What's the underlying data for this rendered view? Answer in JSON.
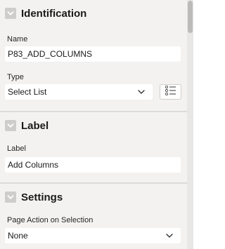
{
  "sections": [
    {
      "title": "Identification",
      "fields": [
        {
          "label": "Name",
          "value": "P83_ADD_COLUMNS"
        },
        {
          "label": "Type",
          "value": "Select List"
        }
      ]
    },
    {
      "title": "Label",
      "fields": [
        {
          "label": "Label",
          "value": "Add Columns"
        }
      ]
    },
    {
      "title": "Settings",
      "fields": [
        {
          "label": "Page Action on Selection",
          "value": "None"
        }
      ]
    }
  ],
  "colors": {
    "panel_bg": "#f3f2f1",
    "toggle_bg": "#cfcdcb",
    "field_bg": "#ffffff",
    "scrollbar_thumb": "#bdbbb9"
  },
  "icons": {
    "collapse": "chevron-down-icon",
    "list_values": "list-icon"
  }
}
